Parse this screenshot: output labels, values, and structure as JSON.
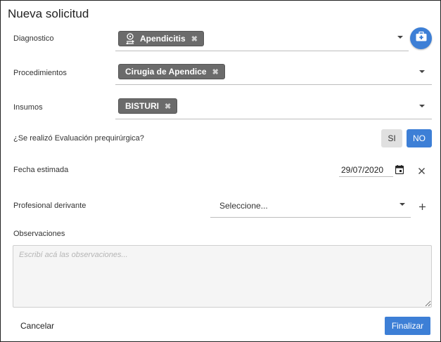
{
  "dialog": {
    "title": "Nueva solicitud",
    "cancel_label": "Cancelar",
    "finalize_label": "Finalizar"
  },
  "diagnostico": {
    "label": "Diagnostico",
    "chips": [
      {
        "label": "Apendicitis",
        "icon": "patient-icon"
      }
    ],
    "action_icon": "first-aid-kit-icon"
  },
  "procedimientos": {
    "label": "Procedimientos",
    "chips": [
      {
        "label": "Cirugia de Apendice"
      }
    ]
  },
  "insumos": {
    "label": "Insumos",
    "chips": [
      {
        "label": "BISTURI"
      }
    ]
  },
  "evaluacion": {
    "label": "¿Se realizó Evaluación prequirúrgica?",
    "options": [
      "SI",
      "NO"
    ],
    "selected": "NO"
  },
  "fecha": {
    "label": "Fecha estimada",
    "value": "29/07/2020"
  },
  "profesional": {
    "label": "Profesional derivante",
    "placeholder": "Seleccione..."
  },
  "observaciones": {
    "label": "Observaciones",
    "placeholder": "Escribí acá las observaciones..."
  },
  "colors": {
    "accent": "#3d7fd6",
    "chip": "#6b6b6b"
  }
}
